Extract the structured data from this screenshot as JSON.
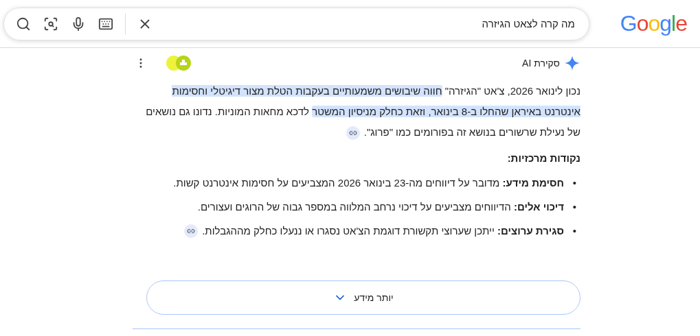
{
  "logo": "Google",
  "search": {
    "value": "מה קרה לצאט הגיזרה"
  },
  "ai_overview": {
    "title": "סקירת AI",
    "paragraph": [
      {
        "text": "נכון לינואר 2026, צ'אט \"הגיזרה\" ",
        "highlighted": false
      },
      {
        "text": "חווה שיבושים משמעותיים בעקבות הטלת מצור דיגיטלי וחסימות אינטרנט באיראן שהחלו ב-8 בינואר, וזאת כחלק מניסיון המשטר",
        "highlighted": true
      },
      {
        "text": " לדכא מחאות המוניות. נדונו גם נושאים של נעילת שרשורים בנושא זה בפורומים כמו \"פרוג\".",
        "highlighted": false
      }
    ],
    "paragraph_link": true,
    "heading": "נקודות מרכזיות:",
    "bullets": [
      {
        "marker": "•",
        "label": "חסימת מידע:",
        "text": " מדובר על דיווחים מה-23 בינואר 2026 המצביעים על חסימות אינטרנט קשות.",
        "link": false
      },
      {
        "marker": "•",
        "label": "דיכוי אלים:",
        "text": " הדיווחים מצביעים על דיכוי נרחב המלווה במספר גבוה של הרוגים ועצורים.",
        "link": false
      },
      {
        "marker": "•",
        "label": "סגירת ערוצים:",
        "text": " ייתכן שערוצי תקשורת דוגמת הצ'אט נסגרו או ננעלו כחלק מההגבלות.",
        "link": true
      }
    ],
    "more_button": "יותר מידע"
  }
}
